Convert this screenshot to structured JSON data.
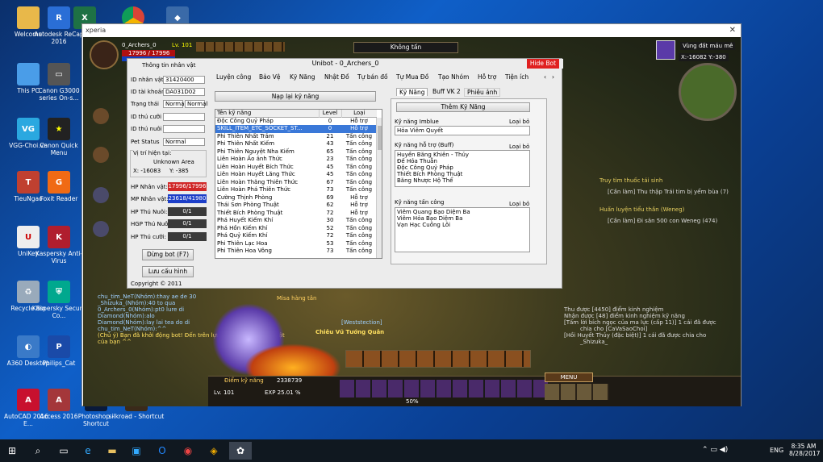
{
  "desktop_icons": [
    "Welcome",
    "Autodesk ReCap 2016",
    "This PC",
    "Canon G3000 series On-s...",
    "VGG-Choi.vn",
    "Canon Quick Menu",
    "TieuNgao",
    "Foxit Reader",
    "UniKey",
    "Kaspersky Anti-Virus",
    "Recycle Bin",
    "Kaspersky Secure Co...",
    "A360 Desktop",
    "Philips_Cat",
    "AutoCAD 2016 - E...",
    "Access 2016",
    "Photoshop - Shortcut",
    "silkroad - Shortcut"
  ],
  "window": {
    "title": "xperia"
  },
  "game": {
    "char_name": "0_Archers_0",
    "level": "Lv. 101",
    "hp": "17996 / 17996",
    "minimap_title": "Vùng đất máu mê",
    "coords": "X:-16082  Y:-380",
    "target_button": "Không tấn",
    "quest1_title": "Truy tìm thuốc tái sinh",
    "quest1_detail": "[Cần làm] Thu thập Trái tim bị yểm bùa (7)",
    "quest2_title": "Huấn luyện tiểu thần (Weneg)",
    "quest2_detail": "[Cần làm] Đi săn 500 con Weneg (474)",
    "chat": [
      "chu_tim_NeT(Nhóm):thay ae de 30",
      "_Shizuka_(Nhóm):40 to qua",
      "0_Archers_0(Nhóm):pt0 lure di",
      "Diamond(Nhóm):alo",
      "Diamond(Nhóm):lay lai tea do di",
      "chu_tim_NeT(Nhóm):^^",
      "(Chủ ý) Bạn đã khởi động bot! Đến trên lựu cấu hình cho nhân vật của bạn ^^"
    ],
    "log": [
      "Thu được [4450] điểm kinh nghiệm",
      "Nhận được [48] điểm kinh nghiệm kỹ năng",
      "[Tấm lời bích ngọc của ma lực (cấp 11)] 1 cái đã được",
      "chia cho [CaVaSaoChoi]",
      "[Hồi Huyết Thủy (đặc biệt)] 1 cái đã được chia cho",
      "_Shizuka_"
    ],
    "npc1": "Misa hàng tân",
    "npc2": "Chiêu Vũ Tướng Quân",
    "npc2_level": "[Weststection]",
    "hud_skill_points": "Điểm kỹ năng",
    "hud_skill_value": "2338739",
    "hud_level": "Lv. 101",
    "hud_exp": "EXP 25.01 %",
    "hud_percent": "50%",
    "menu": "MENU"
  },
  "bot": {
    "title": "Unibot - 0_Archers_0",
    "hide": "Hide Bot",
    "left_title": "Thông tin nhân vật",
    "fields": [
      {
        "label": "ID nhân vật",
        "value": "31420400"
      },
      {
        "label": "ID tài khoản",
        "value": "DA031D02"
      },
      {
        "label": "Trạng thái",
        "value": "Normal",
        "value2": "Normal"
      },
      {
        "label": "ID thú cưỡi",
        "value": ""
      },
      {
        "label": "ID thú nuôi",
        "value": ""
      },
      {
        "label": "Pet Status",
        "value": "Normal"
      }
    ],
    "location_label": "Vị trí hiện tại:",
    "area": "Unknown Area",
    "x": "X:  -16083",
    "y": "Y:    -385",
    "hp_label": "HP Nhân vật:",
    "hp_value": "17996/17996",
    "mp_label": "MP Nhân vật:",
    "mp_value": "23618/41980",
    "hp_pet_label": "HP Thú Nuôi:",
    "hp_pet": "0/1",
    "hgp_label": "HGP Thú Nuôi:",
    "hgp": "0/1",
    "hp_mount_label": "HP Thú cưỡi:",
    "hp_mount": "0/1",
    "stop_btn": "Dừng bot (F7)",
    "save_btn": "Lưu cấu hình",
    "copyright": "Copyright © 2011",
    "menu": [
      "Luyện công",
      "Bảo Vệ",
      "Kỹ Năng",
      "Nhật Đồ",
      "Tự bán đồ",
      "Tự Mua Đồ",
      "Tạo Nhóm",
      "Hỗ trợ",
      "Tiện ích"
    ],
    "load_skill": "Nạp lại kỹ năng",
    "skill_headers": [
      "Tên kỹ năng",
      "Level",
      "Loại"
    ],
    "skills": [
      [
        "Độc Công Quỷ Pháp",
        "0",
        "Hỗ trợ"
      ],
      [
        "SKILL_ITEM_ETC_SOCKET_ST...",
        "0",
        "Hỗ trợ"
      ],
      [
        "Phi Thiên Nhất Trảm",
        "21",
        "Tấn công"
      ],
      [
        "Phi Thiên Nhất Kiếm",
        "43",
        "Tấn công"
      ],
      [
        "Phi Thiên Nguyệt Nha Kiếm",
        "65",
        "Tấn công"
      ],
      [
        "Liên Hoàn Ảo ảnh Thức",
        "23",
        "Tấn công"
      ],
      [
        "Liên Hoàn Huyết Bích Thức",
        "45",
        "Tấn công"
      ],
      [
        "Liên Hoàn Huyết Lăng Thức",
        "45",
        "Tấn công"
      ],
      [
        "Liên Hoàn Thăng Thiên Thức",
        "67",
        "Tấn công"
      ],
      [
        "Liên Hoàn Phá Thiên Thức",
        "73",
        "Tấn công"
      ],
      [
        "Cường Thịnh Phòng",
        "69",
        "Hỗ trợ"
      ],
      [
        "Thái Sơn Phòng Thuật",
        "62",
        "Hỗ trợ"
      ],
      [
        "Thiết Bích Phòng Thuật",
        "72",
        "Hỗ trợ"
      ],
      [
        "Phá Huyết Kiếm Khí",
        "30",
        "Tấn công"
      ],
      [
        "Phá Hồn Kiếm Khí",
        "52",
        "Tấn công"
      ],
      [
        "Phá Quỷ Kiếm Khí",
        "72",
        "Tấn công"
      ],
      [
        "Phi Thiên Lạc Hoa",
        "53",
        "Tấn công"
      ],
      [
        "Phi Thiên Hoa Vông",
        "73",
        "Tấn công"
      ]
    ],
    "tabs": [
      "Kỹ Năng",
      "Buff VK 2",
      "Phiêu ảnh"
    ],
    "add_skill": "Thêm Kỹ Năng",
    "imbue_label": "Kỹ năng Imblue",
    "imbue_value": "Hỏa Viêm Quyết",
    "remove": "Loại bỏ",
    "buff_label": "Kỹ năng hỗ trợ (Buff)",
    "buffs": [
      "Huyền Băng Khiên - Thủy",
      "Đế Hỏa Thuẫn",
      "Độc Công Quỷ Pháp",
      "Thiết Bích Phòng Thuật",
      "Băng Nhược Hộ Thể"
    ],
    "attack_label": "Kỹ năng tấn công",
    "attacks": [
      "Viêm Quang Bạo Diệm Ba",
      "Viêm Hỏa Bạo Diệm Ba",
      "Vạn Hạc Cuồng Lôi"
    ]
  },
  "taskbar": {
    "lang": "ENG",
    "time": "8:35 AM",
    "date": "8/28/2017"
  }
}
